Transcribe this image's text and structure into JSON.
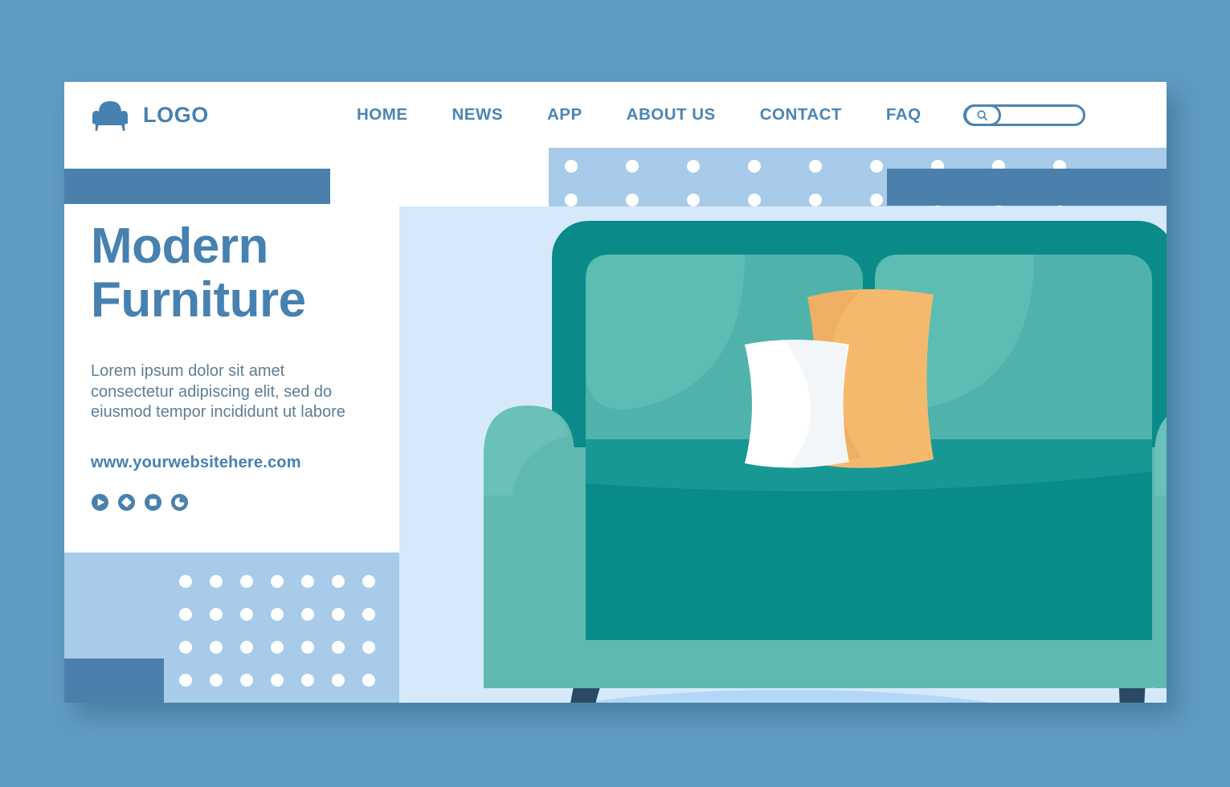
{
  "page": {
    "background_color": "#5f9bc2",
    "card_background": "#ffffff"
  },
  "navbar": {
    "logo_icon": "armchair-icon",
    "logo_text": "LOGO",
    "menu_items": [
      {
        "label": "HOME"
      },
      {
        "label": "NEWS"
      },
      {
        "label": "APP"
      },
      {
        "label": "ABOUT US"
      },
      {
        "label": "CONTACT"
      },
      {
        "label": "FAQ"
      }
    ],
    "search": {
      "icon": "search-icon",
      "value": "",
      "placeholder": ""
    }
  },
  "hero": {
    "headline_line1": "Modern",
    "headline_line2": "Furniture",
    "body_line1": "Lorem ipsum dolor sit amet",
    "body_line2": "consectetur adipiscing elit, sed do",
    "body_line3": "eiusmod tempor incididunt ut labore",
    "website": "www.yourwebsitehere.com",
    "social_icons": [
      {
        "name": "play-circle-icon"
      },
      {
        "name": "diamond-circle-icon"
      },
      {
        "name": "square-circle-icon"
      },
      {
        "name": "ring-circle-icon"
      }
    ]
  },
  "decoration": {
    "bar_left_color": "#4a80ab",
    "bar_right_color": "#4a80ab",
    "dot_band_color": "#a7cbe8",
    "dot_color": "#ffffff",
    "hero_panel_color": "#d6e9fb",
    "dot_band_top_columns": 9,
    "dot_band_top_rows": 2,
    "dot_panel_bottom_columns": 7,
    "dot_panel_bottom_rows": 4
  },
  "illustration": {
    "name": "teal-sofa-illustration",
    "sofa_frame_color": "#0b8a8a",
    "sofa_body_color": "#5fb9b0",
    "sofa_cushion_color": "#098b8b",
    "sofa_highlight_color": "#64bdb4",
    "pillow_white_color": "#ffffff",
    "pillow_orange_color": "#f5b96e",
    "leg_color": "#2a4a63",
    "floor_shadow_color": "#b3d7f7",
    "backdrop_color": "#d6e9fb"
  }
}
